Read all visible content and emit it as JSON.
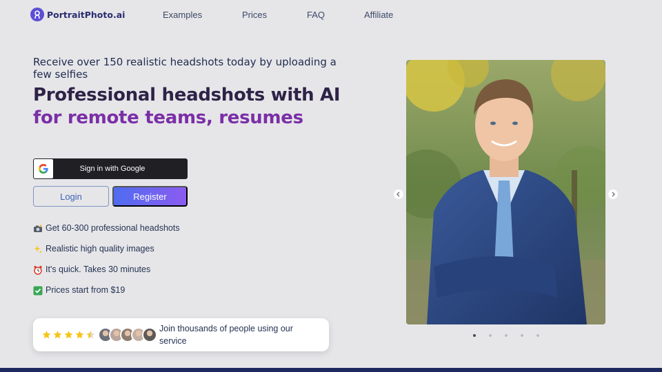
{
  "brand": {
    "name": "PortraitPhoto.ai",
    "color": "#5b4fd6"
  },
  "nav": {
    "items": [
      {
        "label": "Examples"
      },
      {
        "label": "Prices"
      },
      {
        "label": "FAQ"
      },
      {
        "label": "Affiliate"
      }
    ]
  },
  "hero": {
    "subtitle": "Receive over 150 realistic headshots today by uploading a few selfies",
    "title_line1": "Professional headshots with AI",
    "title_line2": "for remote teams, resumes",
    "title_line1_color": "#2e2347",
    "title_line2_color": "#7b2fa6"
  },
  "auth": {
    "google_label": "Sign in with Google",
    "login_label": "Login",
    "register_label": "Register",
    "register_gradient": [
      "#4f6cf0",
      "#8b5cf0"
    ]
  },
  "features": [
    {
      "icon": "camera-flash-icon",
      "text": "Get 60-300 professional headshots"
    },
    {
      "icon": "sparkles-icon",
      "text": "Realistic high quality images"
    },
    {
      "icon": "alarm-clock-icon",
      "text": "It's quick. Takes 30 minutes"
    },
    {
      "icon": "check-mark-icon",
      "text": "Prices start from $19"
    }
  ],
  "social_proof": {
    "rating": 4.5,
    "rating_max": 5,
    "text": "Join thousands of people using our service",
    "avatar_count": 5
  },
  "carousel": {
    "slide_count": 5,
    "active_index": 0,
    "current_image": "man-in-blue-suit-headshot"
  },
  "colors": {
    "background": "#e6e6e9",
    "footer_bar": "#1e2a5e",
    "star": "#f5c518"
  }
}
